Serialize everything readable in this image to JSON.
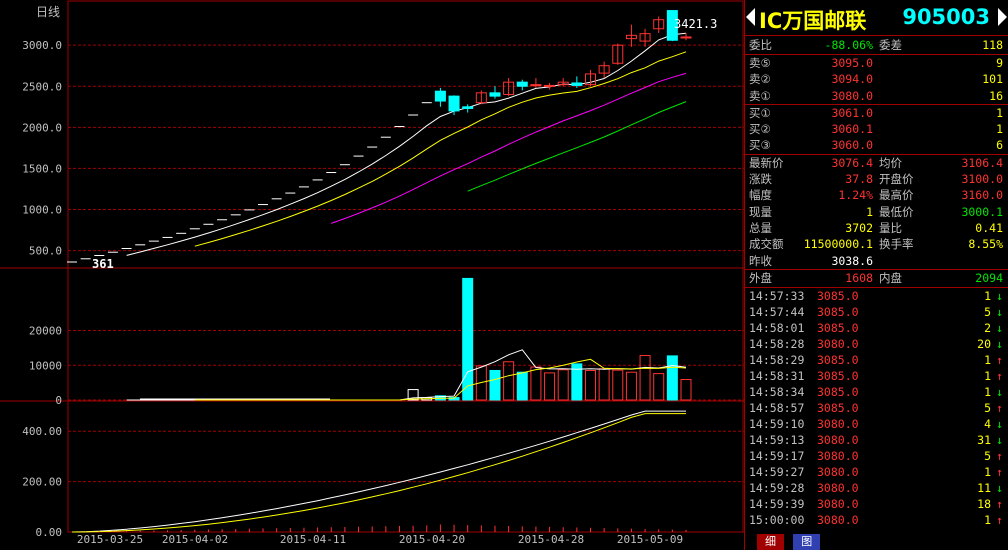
{
  "chart": {
    "period_label": "日线",
    "price_ticks": [
      "3000.0",
      "2500.0",
      "2000.0",
      "1500.0",
      "1000.0",
      "500.0"
    ],
    "volume_ticks": [
      "20000",
      "10000",
      "0"
    ],
    "indicator_ticks": [
      "400.00",
      "200.00",
      "0.00"
    ],
    "date_labels": [
      "2015-03-25",
      "2015-04-02",
      "2015-04-11",
      "2015-04-20",
      "2015-04-28",
      "2015-05-09"
    ],
    "high_label": "3421.3",
    "low_label": "361",
    "colors": {
      "up": "#ff3232",
      "down": "#00ffff",
      "ma5": "#ffffff",
      "ma10": "#ffff00",
      "ma20": "#ff00ff",
      "ma60": "#00e600",
      "grid": "#a00000"
    }
  },
  "chart_data": {
    "type": "candlestick",
    "xlabels": [
      "2015-03-25",
      "2015-04-02",
      "2015-04-11",
      "2015-04-20",
      "2015-04-28",
      "2015-05-09"
    ],
    "ohlc": [
      [
        361,
        361,
        361,
        361
      ],
      [
        400,
        400,
        400,
        400
      ],
      [
        440,
        440,
        440,
        440
      ],
      [
        480,
        480,
        480,
        480
      ],
      [
        525,
        525,
        525,
        525
      ],
      [
        570,
        570,
        570,
        570
      ],
      [
        615,
        615,
        615,
        615
      ],
      [
        660,
        660,
        660,
        660
      ],
      [
        710,
        710,
        710,
        710
      ],
      [
        765,
        765,
        765,
        765
      ],
      [
        820,
        820,
        820,
        820
      ],
      [
        875,
        875,
        875,
        875
      ],
      [
        935,
        935,
        935,
        935
      ],
      [
        995,
        995,
        995,
        995
      ],
      [
        1060,
        1060,
        1060,
        1060
      ],
      [
        1130,
        1130,
        1130,
        1130
      ],
      [
        1200,
        1200,
        1200,
        1200
      ],
      [
        1275,
        1275,
        1275,
        1275
      ],
      [
        1360,
        1360,
        1360,
        1360
      ],
      [
        1450,
        1450,
        1450,
        1450
      ],
      [
        1545,
        1545,
        1545,
        1545
      ],
      [
        1650,
        1650,
        1650,
        1650
      ],
      [
        1760,
        1760,
        1760,
        1760
      ],
      [
        1880,
        1880,
        1880,
        1880
      ],
      [
        2010,
        2010,
        2010,
        2010
      ],
      [
        2150,
        2150,
        2150,
        2150
      ],
      [
        2300,
        2300,
        2300,
        2300
      ],
      [
        2440,
        2480,
        2250,
        2320
      ],
      [
        2380,
        2390,
        2150,
        2200
      ],
      [
        2250,
        2280,
        2180,
        2230
      ],
      [
        2300,
        2450,
        2280,
        2420
      ],
      [
        2420,
        2500,
        2350,
        2380
      ],
      [
        2400,
        2600,
        2380,
        2550
      ],
      [
        2550,
        2580,
        2450,
        2500
      ],
      [
        2520,
        2600,
        2480,
        2520
      ],
      [
        2500,
        2540,
        2460,
        2510
      ],
      [
        2520,
        2600,
        2500,
        2550
      ],
      [
        2540,
        2620,
        2480,
        2510
      ],
      [
        2520,
        2700,
        2500,
        2650
      ],
      [
        2660,
        2800,
        2600,
        2750
      ],
      [
        2780,
        3020,
        2760,
        3000
      ],
      [
        3080,
        3250,
        2980,
        3120
      ],
      [
        3050,
        3200,
        2980,
        3140
      ],
      [
        3200,
        3350,
        3150,
        3310
      ],
      [
        3421.3,
        3421.3,
        3050,
        3060
      ],
      [
        3100,
        3150,
        3060,
        3100
      ]
    ],
    "volume": [
      0,
      0,
      0,
      0,
      0,
      0,
      0,
      0,
      0,
      0,
      0,
      0,
      0,
      0,
      0,
      0,
      0,
      0,
      0,
      0,
      0,
      0,
      0,
      0,
      0,
      3000,
      700,
      1200,
      700,
      35000,
      9800,
      8500,
      11000,
      8000,
      9500,
      7800,
      8700,
      10400,
      8500,
      9000,
      8600,
      8000,
      12800,
      7600,
      12700,
      5900
    ],
    "ma_indicator_last": 500.0
  },
  "quote": {
    "name": "IC万国邮联",
    "code": "905003",
    "weibi_label": "委比",
    "weibi_value": "-88.06%",
    "weicha_label": "委差",
    "weicha_value": "118",
    "asks": [
      {
        "label": "卖⑤",
        "price": "3095.0",
        "vol": "9"
      },
      {
        "label": "卖②",
        "price": "3094.0",
        "vol": "101"
      },
      {
        "label": "卖①",
        "price": "3080.0",
        "vol": "16"
      }
    ],
    "bids": [
      {
        "label": "买①",
        "price": "3061.0",
        "vol": "1"
      },
      {
        "label": "买②",
        "price": "3060.1",
        "vol": "1"
      },
      {
        "label": "买③",
        "price": "3060.0",
        "vol": "6"
      }
    ],
    "stats": [
      {
        "l1": "最新价",
        "v1": "3076.4",
        "c1": "red",
        "l2": "均价",
        "v2": "3106.4",
        "c2": "red"
      },
      {
        "l1": "涨跌",
        "v1": "37.8",
        "c1": "red",
        "l2": "开盘价",
        "v2": "3100.0",
        "c2": "red"
      },
      {
        "l1": "幅度",
        "v1": "1.24%",
        "c1": "red",
        "l2": "最高价",
        "v2": "3160.0",
        "c2": "red"
      },
      {
        "l1": "现量",
        "v1": "1",
        "c1": "yellow",
        "l2": "最低价",
        "v2": "3000.1",
        "c2": "green"
      },
      {
        "l1": "总量",
        "v1": "3702",
        "c1": "yellow",
        "l2": "量比",
        "v2": "0.41",
        "c2": "yellow"
      },
      {
        "l1": "成交额",
        "v1": "11500000.1",
        "c1": "yellow",
        "l2": "换手率",
        "v2": "8.55%",
        "c2": "yellow"
      },
      {
        "l1": "昨收",
        "v1": "3038.6",
        "c1": "white",
        "l2": "",
        "v2": "",
        "c2": "white"
      }
    ],
    "outer_label": "外盘",
    "outer_value": "1608",
    "inner_label": "内盘",
    "inner_value": "2094",
    "trades": [
      {
        "time": "14:57:33",
        "price": "3085.0",
        "vol": "1",
        "dir": "↓",
        "c": "green"
      },
      {
        "time": "14:57:44",
        "price": "3085.0",
        "vol": "5",
        "dir": "↓",
        "c": "green"
      },
      {
        "time": "14:58:01",
        "price": "3085.0",
        "vol": "2",
        "dir": "↓",
        "c": "green"
      },
      {
        "time": "14:58:28",
        "price": "3080.0",
        "vol": "20",
        "dir": "↓",
        "c": "green"
      },
      {
        "time": "14:58:29",
        "price": "3085.0",
        "vol": "1",
        "dir": "↑",
        "c": "red"
      },
      {
        "time": "14:58:31",
        "price": "3085.0",
        "vol": "1",
        "dir": "↑",
        "c": "red"
      },
      {
        "time": "14:58:34",
        "price": "3085.0",
        "vol": "1",
        "dir": "↓",
        "c": "green"
      },
      {
        "time": "14:58:57",
        "price": "3085.0",
        "vol": "5",
        "dir": "↑",
        "c": "red"
      },
      {
        "time": "14:59:10",
        "price": "3080.0",
        "vol": "4",
        "dir": "↓",
        "c": "green"
      },
      {
        "time": "14:59:13",
        "price": "3080.0",
        "vol": "31",
        "dir": "↓",
        "c": "green"
      },
      {
        "time": "14:59:17",
        "price": "3080.0",
        "vol": "5",
        "dir": "↑",
        "c": "red"
      },
      {
        "time": "14:59:27",
        "price": "3080.0",
        "vol": "1",
        "dir": "↑",
        "c": "red"
      },
      {
        "time": "14:59:28",
        "price": "3080.0",
        "vol": "11",
        "dir": "↓",
        "c": "green"
      },
      {
        "time": "14:59:39",
        "price": "3080.0",
        "vol": "18",
        "dir": "↑",
        "c": "red"
      },
      {
        "time": "15:00:00",
        "price": "3080.0",
        "vol": "1",
        "dir": "↑",
        "c": "red"
      }
    ],
    "tabs": [
      "细",
      "图"
    ]
  }
}
